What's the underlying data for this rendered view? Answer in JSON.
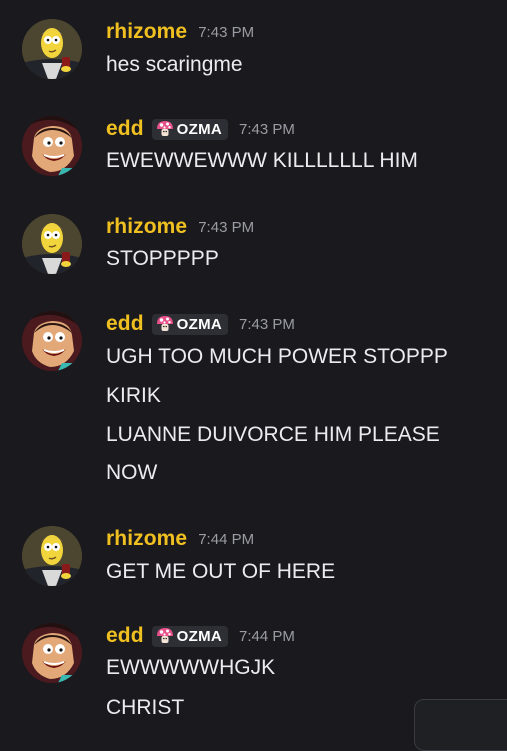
{
  "messages": [
    {
      "username": "rhizome",
      "timestamp": "7:43 PM",
      "tag": null,
      "avatar": "burns-avatar",
      "lines": [
        "hes scaringme"
      ]
    },
    {
      "username": "edd",
      "timestamp": "7:43 PM",
      "tag": "OZMA",
      "avatar": "edd-avatar",
      "lines": [
        "EWEWWEWWW KILLLLLLL HIM"
      ]
    },
    {
      "username": "rhizome",
      "timestamp": "7:43 PM",
      "tag": null,
      "avatar": "burns-avatar",
      "lines": [
        "STOPPPPP"
      ]
    },
    {
      "username": "edd",
      "timestamp": "7:43 PM",
      "tag": "OZMA",
      "avatar": "edd-avatar",
      "lines": [
        "UGH TOO MUCH POWER STOPPP",
        "KIRIK",
        "LUANNE DUIVORCE HIM PLEASE",
        "NOW"
      ]
    },
    {
      "username": "rhizome",
      "timestamp": "7:44 PM",
      "tag": null,
      "avatar": "burns-avatar",
      "lines": [
        "GET ME OUT OF HERE"
      ]
    },
    {
      "username": "edd",
      "timestamp": "7:44 PM",
      "tag": "OZMA",
      "avatar": "edd-avatar",
      "lines": [
        "EWWWWWHGJK",
        "CHRIST"
      ]
    }
  ],
  "colors": {
    "background": "#1a1a1e",
    "username": "#f0c020",
    "text": "#ececef",
    "timestamp": "#9a9ba3",
    "tag_bg": "#2e2f35",
    "tag_icon": "#e8508a"
  },
  "icons": {
    "tag": "mushroom-icon"
  }
}
